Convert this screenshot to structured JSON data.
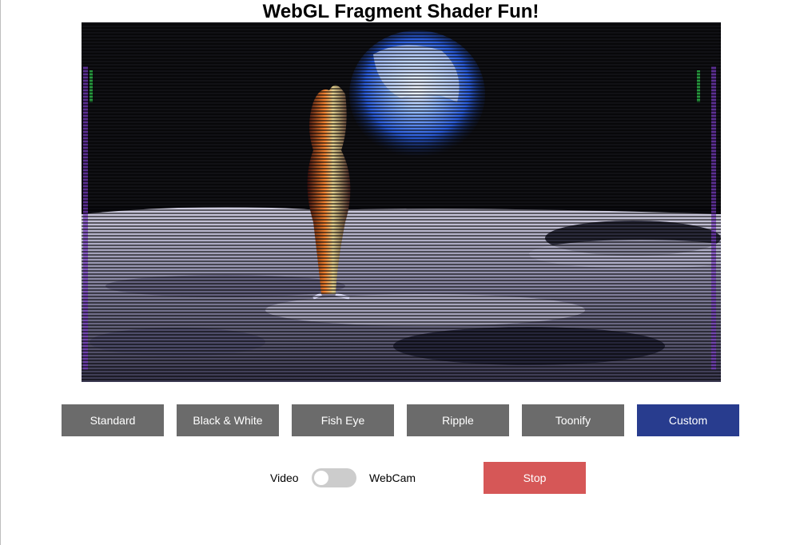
{
  "header": {
    "title": "WebGL Fragment Shader Fun!"
  },
  "shader_buttons": [
    {
      "label": "Standard",
      "state": "inactive"
    },
    {
      "label": "Black & White",
      "state": "inactive"
    },
    {
      "label": "Fish Eye",
      "state": "inactive"
    },
    {
      "label": "Ripple",
      "state": "inactive"
    },
    {
      "label": "Toonify",
      "state": "inactive"
    },
    {
      "label": "Custom",
      "state": "active"
    }
  ],
  "source_switch": {
    "left_label": "Video",
    "right_label": "WebCam",
    "checked": false
  },
  "playback": {
    "stop_label": "Stop"
  },
  "colors": {
    "button_gray": "#6b6b6b",
    "button_active": "#283c8e",
    "button_stop": "#d65757",
    "toggle_off": "#cccccc"
  }
}
